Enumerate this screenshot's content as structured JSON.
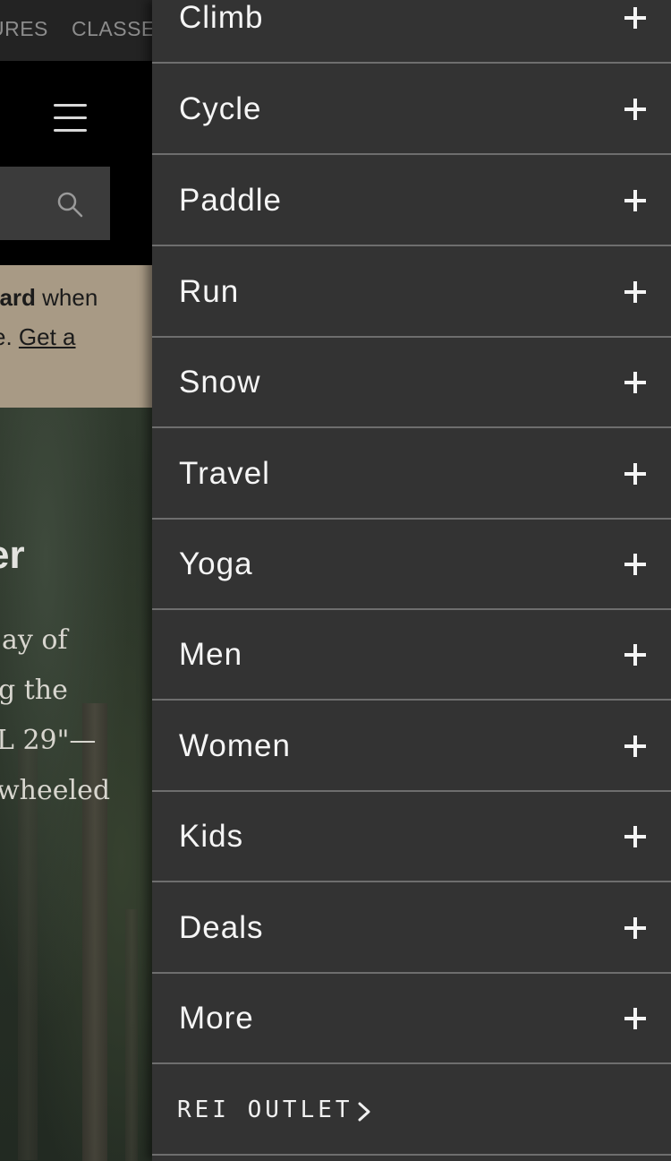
{
  "background_page": {
    "top_nav": [
      "URES",
      "CLASSES"
    ],
    "promo": {
      "line1_bold": "card",
      "line1_rest": " when",
      "line2_prefix": "e. ",
      "line2_link": "Get a"
    },
    "hero": {
      "title": "er",
      "text_lines": [
        "ay of",
        "g the",
        "L 29\"—",
        "wheeled"
      ]
    }
  },
  "menu": {
    "items": [
      {
        "label": "Climb"
      },
      {
        "label": "Cycle"
      },
      {
        "label": "Paddle"
      },
      {
        "label": "Run"
      },
      {
        "label": "Snow"
      },
      {
        "label": "Travel"
      },
      {
        "label": "Yoga"
      },
      {
        "label": "Men"
      },
      {
        "label": "Women"
      },
      {
        "label": "Kids"
      },
      {
        "label": "Deals"
      },
      {
        "label": "More"
      }
    ],
    "outlet_label": "REI OUTLET"
  },
  "colors": {
    "drawer_bg": "#333333",
    "divider": "#6e6e6e",
    "promo_bg": "#a89a85"
  }
}
